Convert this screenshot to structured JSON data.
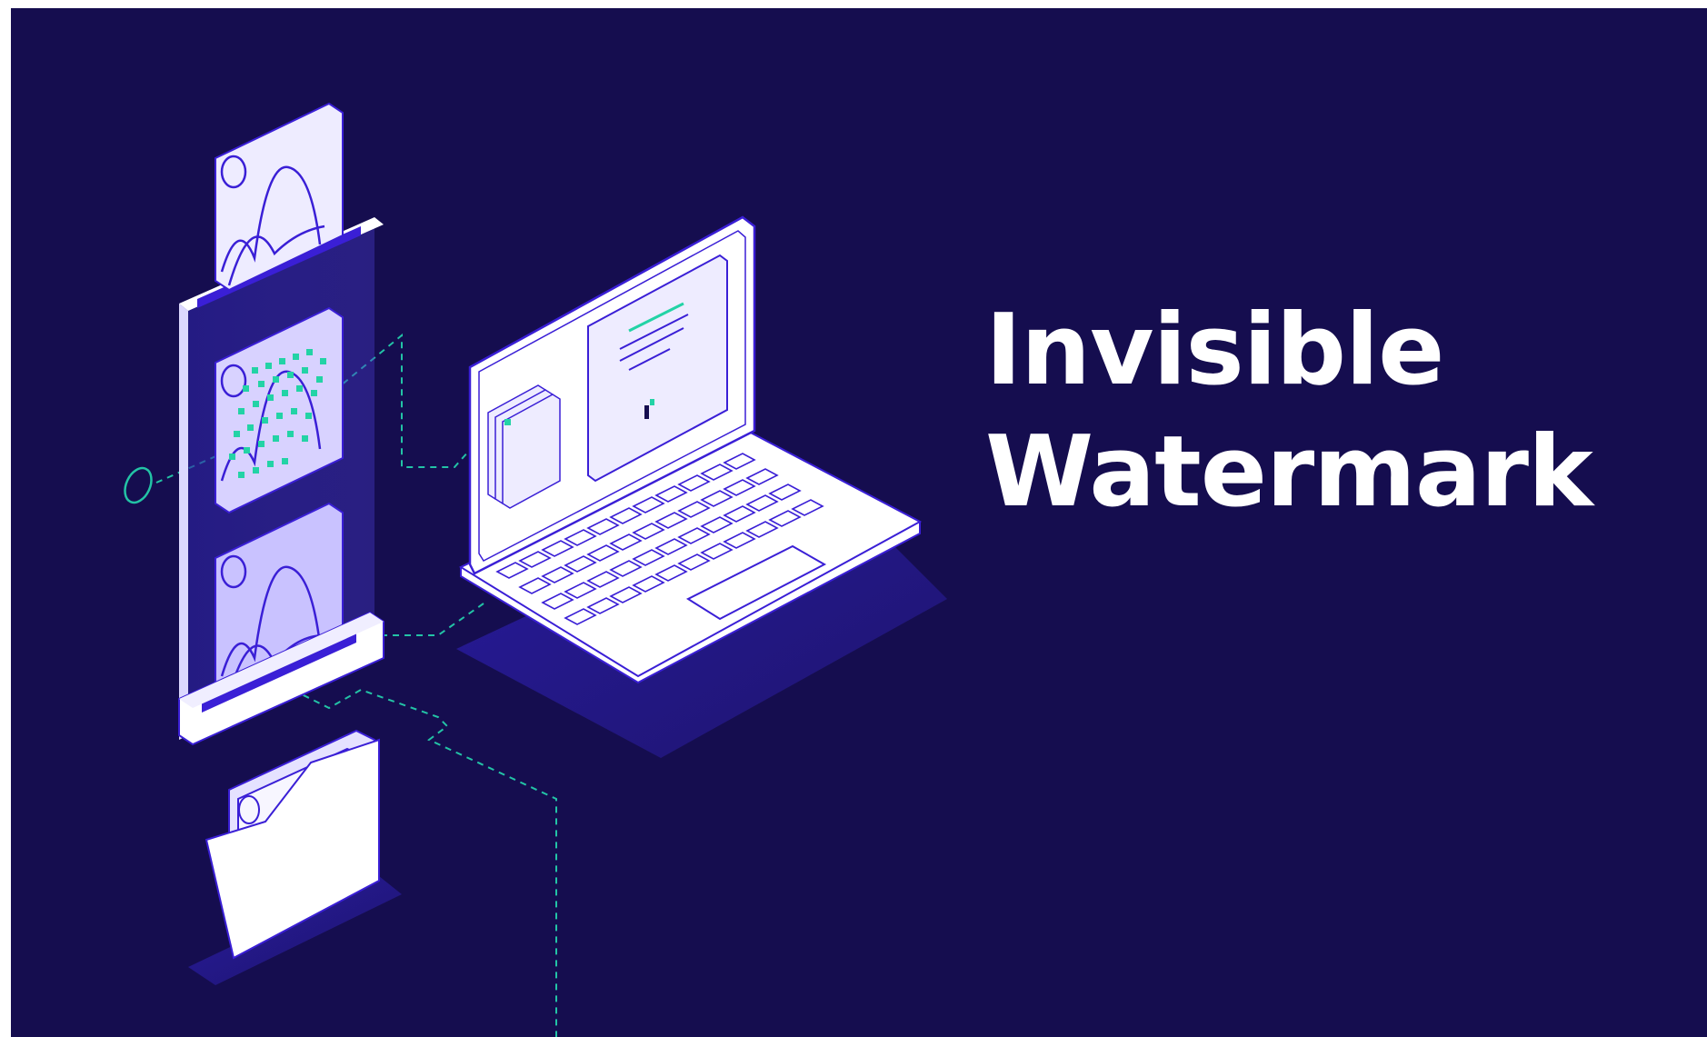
{
  "headline": {
    "line1": "Invisible",
    "line2": "Watermark"
  },
  "colors": {
    "background": "#150d4f",
    "accent_teal": "#23d3a6",
    "outline_violet": "#3a1fd6",
    "panel_light": "#eeecff",
    "text": "#ffffff"
  },
  "icons": [
    "image-card-icon",
    "watermarked-image-card-icon",
    "laptop-icon",
    "folder-icon"
  ]
}
